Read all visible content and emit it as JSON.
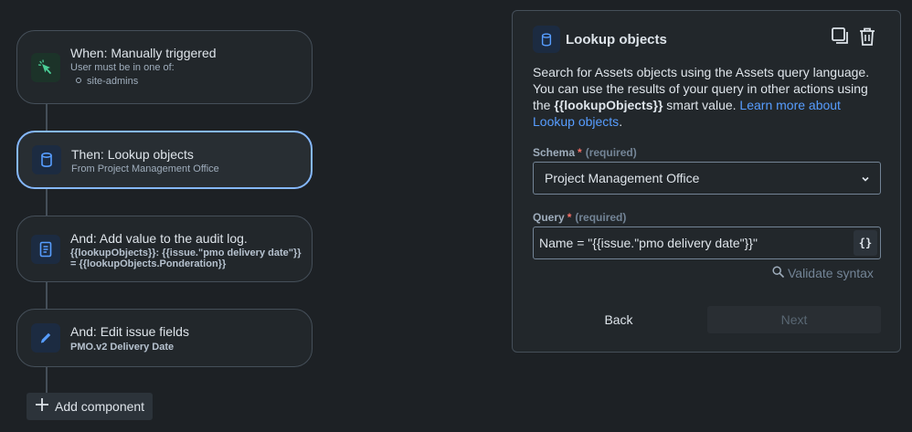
{
  "flow": {
    "trigger": {
      "title": "When: Manually triggered",
      "subtitle": "User must be in one of:",
      "groups": [
        "site-admins"
      ],
      "icon": "cursor-click-icon"
    },
    "lookup": {
      "title": "Then: Lookup objects",
      "subtitle": "From Project Management Office",
      "icon": "database-icon"
    },
    "audit": {
      "title": "And: Add value to the audit log.",
      "line1": "{{lookupObjects}}: {{issue.\"pmo delivery date\"}}",
      "line2": "= {{lookupObjects.Ponderation}}",
      "icon": "document-icon"
    },
    "edit": {
      "title": "And: Edit issue fields",
      "subtitle": "PMO.v2 Delivery Date",
      "icon": "pencil-icon"
    },
    "add_component_label": "Add component"
  },
  "panel": {
    "title": "Lookup objects",
    "description_1": "Search for Assets objects using the Assets query language. You can use the results of your query in other actions using the ",
    "description_bold": "{{lookupObjects}}",
    "description_2": " smart value. ",
    "description_link": "Learn more about Lookup objects",
    "description_end": ".",
    "schema_label": "Schema",
    "required_mark": "*",
    "required_text": "(required)",
    "schema_value": "Project Management Office",
    "query_label": "Query",
    "query_value": "Name = \"{{issue.\"pmo delivery date\"}}\"",
    "braces_label": "{}",
    "validate_label": "Validate syntax",
    "back_label": "Back",
    "next_label": "Next"
  },
  "colors": {
    "background": "#1d2125",
    "accent": "#579dff",
    "selected_border": "#85b8ff",
    "required": "#f87168"
  }
}
